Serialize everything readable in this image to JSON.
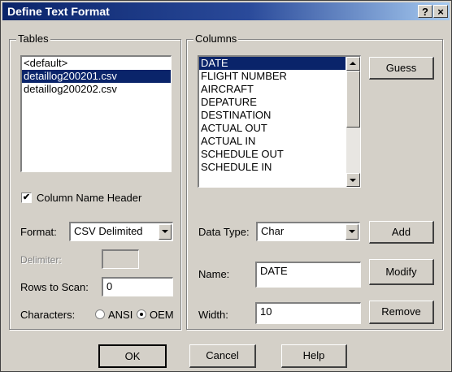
{
  "window": {
    "title": "Define Text Format",
    "help_btn": "?",
    "close_btn": "×"
  },
  "tables": {
    "legend": "Tables",
    "items": [
      "<default>",
      "detaillog200201.csv",
      "detaillog200202.csv"
    ],
    "selected_index": 1,
    "column_name_header_label": "Column Name Header",
    "column_name_header_checked": true,
    "format_label": "Format:",
    "format_value": "CSV Delimited",
    "delimiter_label": "Delimiter:",
    "delimiter_value": "",
    "rows_to_scan_label": "Rows to Scan:",
    "rows_to_scan_value": "0",
    "characters_label": "Characters:",
    "charset_ansi": "ANSI",
    "charset_oem": "OEM",
    "charset_selected": "OEM"
  },
  "columns": {
    "legend": "Columns",
    "items": [
      "DATE",
      "FLIGHT NUMBER",
      "AIRCRAFT",
      "DEPATURE",
      "DESTINATION",
      "ACTUAL OUT",
      "ACTUAL IN",
      "SCHEDULE OUT",
      "SCHEDULE IN"
    ],
    "selected_index": 0,
    "guess_label": "Guess",
    "data_type_label": "Data Type:",
    "data_type_value": "Char",
    "add_label": "Add",
    "name_label": "Name:",
    "name_value": "DATE",
    "modify_label": "Modify",
    "width_label": "Width:",
    "width_value": "10",
    "remove_label": "Remove"
  },
  "footer": {
    "ok_label": "OK",
    "cancel_label": "Cancel",
    "help_label": "Help"
  }
}
